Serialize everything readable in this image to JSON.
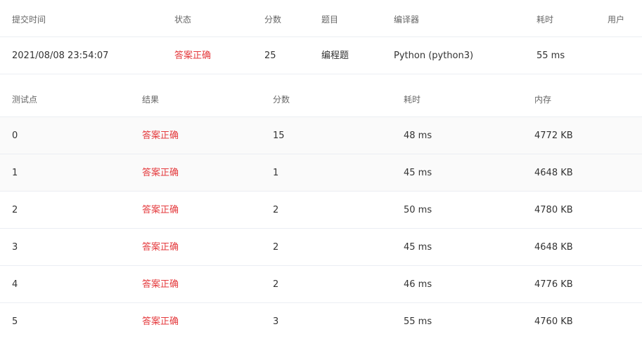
{
  "summary": {
    "headers": [
      "提交时间",
      "状态",
      "分数",
      "题目",
      "编译器",
      "耗时",
      "用户"
    ],
    "row": {
      "time": "2021/08/08 23:54:07",
      "status": "答案正确",
      "score": "25",
      "problem": "编程题",
      "compiler": "Python (python3)",
      "duration": "55 ms",
      "user": ""
    }
  },
  "cases": {
    "headers": [
      "测试点",
      "结果",
      "分数",
      "耗时",
      "内存"
    ],
    "rows": [
      {
        "id": "0",
        "result": "答案正确",
        "score": "15",
        "duration": "48 ms",
        "memory": "4772 KB"
      },
      {
        "id": "1",
        "result": "答案正确",
        "score": "1",
        "duration": "45 ms",
        "memory": "4648 KB"
      },
      {
        "id": "2",
        "result": "答案正确",
        "score": "2",
        "duration": "50 ms",
        "memory": "4780 KB"
      },
      {
        "id": "3",
        "result": "答案正确",
        "score": "2",
        "duration": "45 ms",
        "memory": "4648 KB"
      },
      {
        "id": "4",
        "result": "答案正确",
        "score": "2",
        "duration": "46 ms",
        "memory": "4776 KB"
      },
      {
        "id": "5",
        "result": "答案正确",
        "score": "3",
        "duration": "55 ms",
        "memory": "4760 KB"
      }
    ]
  },
  "colors": {
    "accepted": "#e4393c",
    "row_alt": "#fafafa",
    "border": "#ebeef3"
  }
}
